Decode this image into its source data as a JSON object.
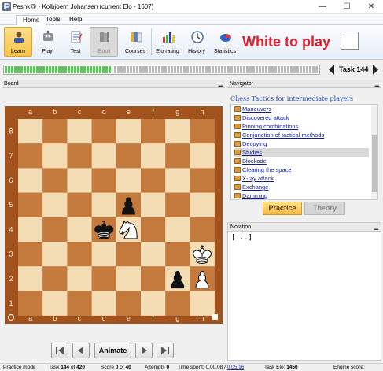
{
  "window": {
    "title": "Peshk@  -  Kolbjoern Johansen (current Elo - 1607)",
    "minimize": "—",
    "maximize": "☐",
    "close": "✕"
  },
  "menu": {
    "items": [
      {
        "label": "Home",
        "active": true
      },
      {
        "label": "Tools",
        "active": false
      },
      {
        "label": "Help",
        "active": false
      }
    ]
  },
  "ribbon": {
    "buttons": [
      {
        "label": "Learn",
        "icon": "learn-icon",
        "state": "selected"
      },
      {
        "label": "Play",
        "icon": "robot-icon",
        "state": "normal"
      },
      {
        "label": "Test",
        "icon": "test-icon",
        "state": "normal"
      },
      {
        "label": "iBook",
        "icon": "ibook-icon",
        "state": "disabled"
      },
      {
        "label": "Courses",
        "icon": "courses-icon",
        "state": "normal"
      },
      {
        "label": "Elo rating",
        "icon": "elo-chart-icon",
        "state": "normal"
      },
      {
        "label": "History",
        "icon": "history-clock-icon",
        "state": "normal"
      },
      {
        "label": "Statistics",
        "icon": "pie-chart-icon",
        "state": "normal"
      }
    ],
    "side_to_move": "White to play",
    "side_color": "#e0202c"
  },
  "task": {
    "label": "Task 144",
    "progress_fraction": 0.343,
    "total": 420,
    "current": 144
  },
  "board_pane": {
    "title": "Board",
    "files": [
      "a",
      "b",
      "c",
      "d",
      "e",
      "f",
      "g",
      "h"
    ],
    "ranks": [
      "8",
      "7",
      "6",
      "5",
      "4",
      "3",
      "2",
      "1"
    ],
    "light_square": "#f4dcb4",
    "dark_square": "#c47a3c",
    "pieces": [
      {
        "square": "e5",
        "piece": "black-pawn"
      },
      {
        "square": "d4",
        "piece": "black-king"
      },
      {
        "square": "e4",
        "piece": "white-knight"
      },
      {
        "square": "h3",
        "piece": "white-king"
      },
      {
        "square": "g2",
        "piece": "black-pawn"
      },
      {
        "square": "h2",
        "piece": "white-pawn"
      }
    ]
  },
  "controls": {
    "first": "first-move-icon",
    "back": "prev-move-icon",
    "animate": "Animate",
    "forward": "next-move-icon",
    "last": "last-move-icon"
  },
  "navigator": {
    "title": "Navigator",
    "heading": "Chess Tactics for intermediate players",
    "items": [
      {
        "label": "Maneuvers",
        "selected": false
      },
      {
        "label": "Discovered attack",
        "selected": false
      },
      {
        "label": "Pinning combinations",
        "selected": false
      },
      {
        "label": "Conjunction of tactical methods",
        "selected": false
      },
      {
        "label": "Decoying",
        "selected": false
      },
      {
        "label": "Studies",
        "selected": true
      },
      {
        "label": "Blockade",
        "selected": false
      },
      {
        "label": "Clearing the space",
        "selected": false
      },
      {
        "label": "X-ray attack",
        "selected": false
      },
      {
        "label": "Exchange",
        "selected": false
      },
      {
        "label": "Damming",
        "selected": false
      }
    ],
    "practice_tab": "Practice",
    "theory_tab": "Theory"
  },
  "notation": {
    "title": "Notation",
    "text": "[...]"
  },
  "status": {
    "mode": "Practice mode",
    "task_prefix": "Task",
    "task_value": "144",
    "task_of": "of",
    "task_total": "420",
    "score_prefix": "Score",
    "score_value": "0",
    "score_of": "of",
    "score_total": "40",
    "attempts_prefix": "Attempts",
    "attempts_value": "0",
    "time_prefix": "Time spent:",
    "time_value": "0.00.08",
    "time_sep": "/",
    "time_link": "0.05.16",
    "elo_prefix": "Task Elo:",
    "elo_value": "1450",
    "engine_prefix": "Engine score:"
  }
}
